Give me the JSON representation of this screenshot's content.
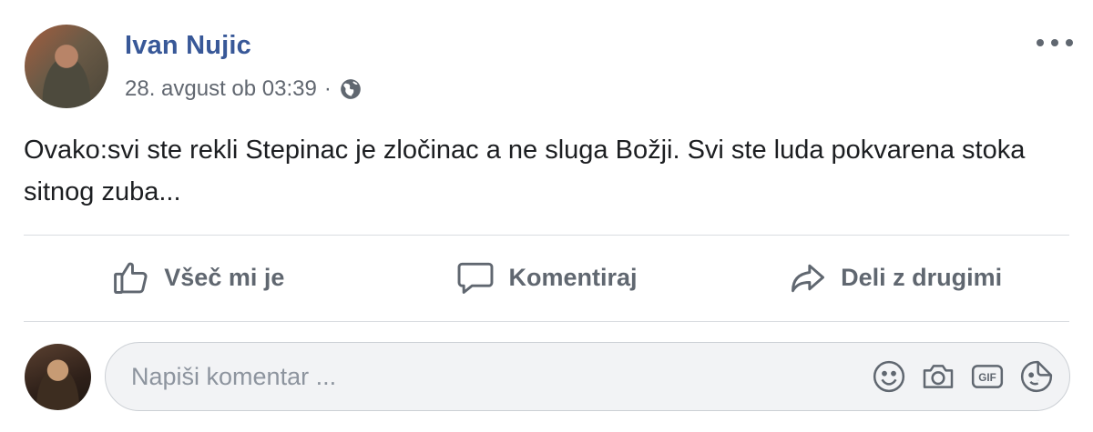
{
  "post": {
    "author": "Ivan Nujic",
    "timestamp": "28. avgust ob 03:39",
    "separator": "·",
    "privacy_icon": "globe-icon",
    "more_icon": "more-options-icon",
    "text": "Ovako:svi ste rekli Stepinac je zločinac a ne sluga Božji. Svi ste luda pokvarena stoka sitnog zuba..."
  },
  "actions": {
    "like_label": "Všeč mi je",
    "comment_label": "Komentiraj",
    "share_label": "Deli z drugimi"
  },
  "comment": {
    "placeholder": "Napiši komentar ...",
    "icons": [
      "emoji-icon",
      "camera-icon",
      "gif-icon",
      "sticker-icon"
    ]
  },
  "colors": {
    "author_link": "#385898",
    "secondary_text": "#616770",
    "action_text": "#606770",
    "divider": "#dadde1",
    "input_bg": "#f2f3f5"
  }
}
